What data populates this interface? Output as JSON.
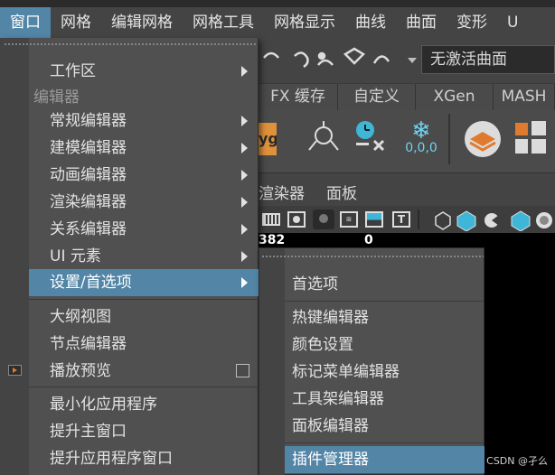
{
  "menubar": {
    "items": [
      "窗口",
      "网格",
      "编辑网格",
      "网格工具",
      "网格显示",
      "曲线",
      "曲面",
      "变形",
      "U"
    ]
  },
  "toolbar": {
    "surface_dropdown": "无激活曲面"
  },
  "shelf_tabs": [
    "FX 缓存",
    "自定义",
    "XGen",
    "MASH"
  ],
  "shelf": {
    "snowflake_label": "0,0,0",
    "ffyg_label": "yg"
  },
  "panel_menu": [
    "渲染器",
    "面板"
  ],
  "viewport": {
    "hud_left": "382",
    "hud_right": "0"
  },
  "main_dropdown": {
    "items": [
      {
        "label": "工作区",
        "submenu": true
      },
      {
        "section": "编辑器"
      },
      {
        "label": "常规编辑器",
        "submenu": true
      },
      {
        "label": "建模编辑器",
        "submenu": true
      },
      {
        "label": "动画编辑器",
        "submenu": true
      },
      {
        "label": "渲染编辑器",
        "submenu": true
      },
      {
        "label": "关系编辑器",
        "submenu": true
      },
      {
        "label": "UI 元素",
        "submenu": true
      },
      {
        "label": "设置/首选项",
        "submenu": true,
        "highlighted": true
      },
      {
        "label": "大纲视图"
      },
      {
        "label": "节点编辑器"
      },
      {
        "label": "播放预览",
        "checkbox": false
      },
      {
        "label": "最小化应用程序"
      },
      {
        "label": "提升主窗口"
      },
      {
        "label": "提升应用程序窗口"
      }
    ]
  },
  "submenu": {
    "items": [
      {
        "label": "首选项"
      },
      {
        "label": "热键编辑器"
      },
      {
        "label": "颜色设置"
      },
      {
        "label": "标记菜单编辑器"
      },
      {
        "label": "工具架编辑器"
      },
      {
        "label": "面板编辑器"
      },
      {
        "label": "插件管理器",
        "highlighted": true
      }
    ]
  },
  "watermark": "CSDN @孑么",
  "colors": {
    "highlight": "#5285a6",
    "menu_bg": "#505050",
    "gutter_bg": "#444444",
    "viewport_bg": "#000000",
    "accent_orange": "#e07a2e",
    "accent_cyan": "#3fb6d8"
  }
}
